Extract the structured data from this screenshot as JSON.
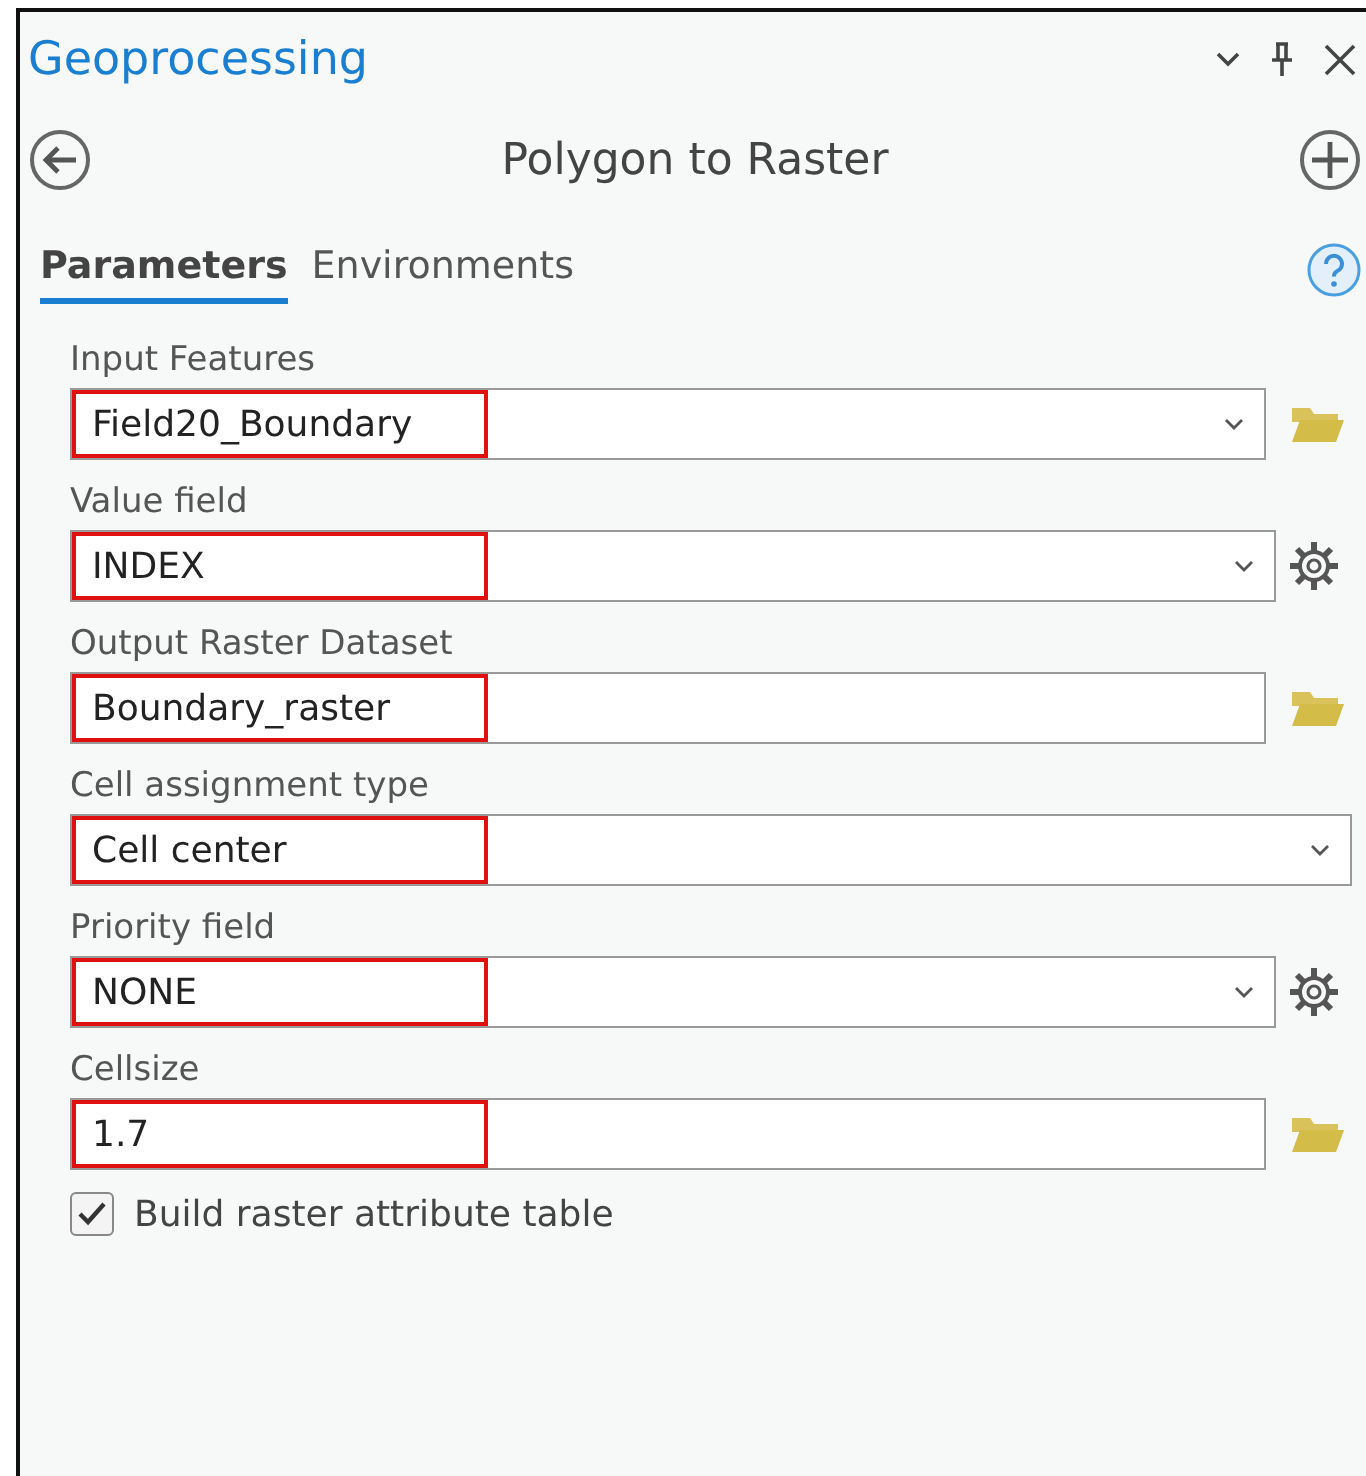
{
  "pane": {
    "title": "Geoprocessing"
  },
  "tool": {
    "title": "Polygon to Raster"
  },
  "tabs": [
    {
      "label": "Parameters",
      "selected": true
    },
    {
      "label": "Environments",
      "selected": false
    }
  ],
  "parameters": [
    {
      "label": "Input Features",
      "value": "Field20_Boundary",
      "dropdown": true,
      "kind": "folder",
      "highlighted": true
    },
    {
      "label": "Value field",
      "value": "INDEX",
      "dropdown": true,
      "kind": "gear",
      "highlighted": true
    },
    {
      "label": "Output Raster Dataset",
      "value": "Boundary_raster",
      "dropdown": false,
      "kind": "folder",
      "highlighted": true
    },
    {
      "label": "Cell assignment type",
      "value": "Cell center",
      "dropdown": true,
      "kind": "plain",
      "highlighted": true
    },
    {
      "label": "Priority field",
      "value": "NONE",
      "dropdown": true,
      "kind": "gear",
      "highlighted": true
    },
    {
      "label": "Cellsize",
      "value": "1.7",
      "dropdown": false,
      "kind": "folder",
      "highlighted": true
    }
  ],
  "options": [
    {
      "label": "Build raster attribute table",
      "checked": true
    }
  ]
}
